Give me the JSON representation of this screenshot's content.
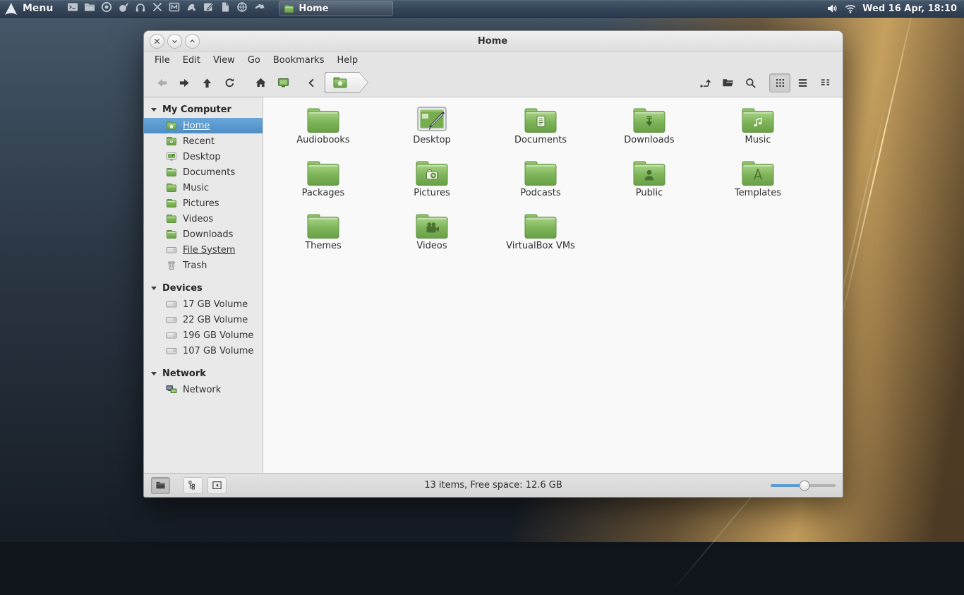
{
  "panel": {
    "logo_icon": "arch",
    "menu_label": "Menu",
    "launchers": [
      {
        "icon": "terminal"
      },
      {
        "icon": "file-manager"
      },
      {
        "icon": "web-browser"
      },
      {
        "icon": "paintbrush"
      },
      {
        "icon": "headphones"
      },
      {
        "icon": "crossed-tools"
      },
      {
        "icon": "m-window"
      },
      {
        "icon": "sewing-tool"
      },
      {
        "icon": "text-editor"
      },
      {
        "icon": "document"
      },
      {
        "icon": "globe"
      },
      {
        "icon": "faucet"
      }
    ],
    "task_button": {
      "icon": "folder-green",
      "label": "Home"
    },
    "tray": {
      "icons": [
        {
          "icon": "volume"
        },
        {
          "icon": "wifi"
        }
      ],
      "clock": "Wed 16 Apr, 18:10"
    }
  },
  "window": {
    "title": "Home",
    "controls": [
      {
        "icon": "close"
      },
      {
        "icon": "chevron-down"
      },
      {
        "icon": "chevron-up"
      }
    ],
    "menubar": [
      {
        "label": "File"
      },
      {
        "label": "Edit"
      },
      {
        "label": "View"
      },
      {
        "label": "Go"
      },
      {
        "label": "Bookmarks"
      },
      {
        "label": "Help"
      }
    ],
    "toolbar": {
      "nav_buttons": [
        {
          "icon": "back",
          "disabled": true
        },
        {
          "icon": "forward"
        },
        {
          "icon": "up"
        },
        {
          "icon": "refresh"
        }
      ],
      "place_buttons": [
        {
          "icon": "home"
        },
        {
          "icon": "desktop-screen"
        }
      ],
      "breadcrumb_scroll": {
        "icon": "chevron-left"
      },
      "breadcrumb": {
        "icon": "home-folder"
      },
      "action_buttons": [
        {
          "icon": "location-edit"
        },
        {
          "icon": "open-folder"
        },
        {
          "icon": "search"
        }
      ],
      "view_buttons": [
        {
          "icon": "view-grid",
          "active": true
        },
        {
          "icon": "view-list"
        },
        {
          "icon": "view-compact"
        }
      ]
    },
    "sidebar": {
      "my_computer": {
        "header": "My Computer",
        "items": [
          {
            "label": "Home",
            "icon": "folder-home-small",
            "selected": true,
            "underlined": true
          },
          {
            "label": "Recent",
            "icon": "folder-recent-small"
          },
          {
            "label": "Desktop",
            "icon": "desktop-small"
          },
          {
            "label": "Documents",
            "icon": "folder-small"
          },
          {
            "label": "Music",
            "icon": "folder-small"
          },
          {
            "label": "Pictures",
            "icon": "folder-small"
          },
          {
            "label": "Videos",
            "icon": "folder-small"
          },
          {
            "label": "Downloads",
            "icon": "folder-small"
          },
          {
            "label": "File System",
            "icon": "drive-small",
            "underlined": true
          },
          {
            "label": "Trash",
            "icon": "trash-small"
          }
        ]
      },
      "devices": {
        "header": "Devices",
        "items": [
          {
            "label": "17 GB Volume",
            "icon": "drive-small"
          },
          {
            "label": "22 GB Volume",
            "icon": "drive-small"
          },
          {
            "label": "196 GB Volume",
            "icon": "drive-small"
          },
          {
            "label": "107 GB Volume",
            "icon": "drive-small"
          }
        ]
      },
      "network": {
        "header": "Network",
        "items": [
          {
            "label": "Network",
            "icon": "network-small"
          }
        ]
      }
    },
    "files": [
      {
        "name": "Audiobooks",
        "icon": "folder-large"
      },
      {
        "name": "Desktop",
        "icon": "desktop-large"
      },
      {
        "name": "Documents",
        "icon": "folder-large",
        "emblem": "emblem-document"
      },
      {
        "name": "Downloads",
        "icon": "folder-large",
        "emblem": "emblem-download"
      },
      {
        "name": "Music",
        "icon": "folder-large",
        "emblem": "emblem-music"
      },
      {
        "name": "Packages",
        "icon": "folder-large"
      },
      {
        "name": "Pictures",
        "icon": "folder-large",
        "emblem": "emblem-camera"
      },
      {
        "name": "Podcasts",
        "icon": "folder-large"
      },
      {
        "name": "Public",
        "icon": "folder-large",
        "emblem": "emblem-person"
      },
      {
        "name": "Templates",
        "icon": "folder-large",
        "emblem": "emblem-compass"
      },
      {
        "name": "Themes",
        "icon": "folder-large"
      },
      {
        "name": "Videos",
        "icon": "folder-large",
        "emblem": "emblem-video"
      },
      {
        "name": "VirtualBox VMs",
        "icon": "folder-large"
      }
    ],
    "statusbar": {
      "buttons": [
        {
          "icon": "places",
          "active": true
        },
        {
          "icon": "treeview"
        },
        {
          "icon": "hide-sidebar"
        }
      ],
      "text": "13 items, Free space: 12.6 GB",
      "zoom_percent": 52
    }
  },
  "colors": {
    "selection_blue": "#4d8ec6",
    "folder_green": "#7db356",
    "slider_blue": "#5b9bd0",
    "panel_top": "#46596c",
    "panel_bottom": "#2b3a4b",
    "gold_accent": "#cda45e"
  }
}
